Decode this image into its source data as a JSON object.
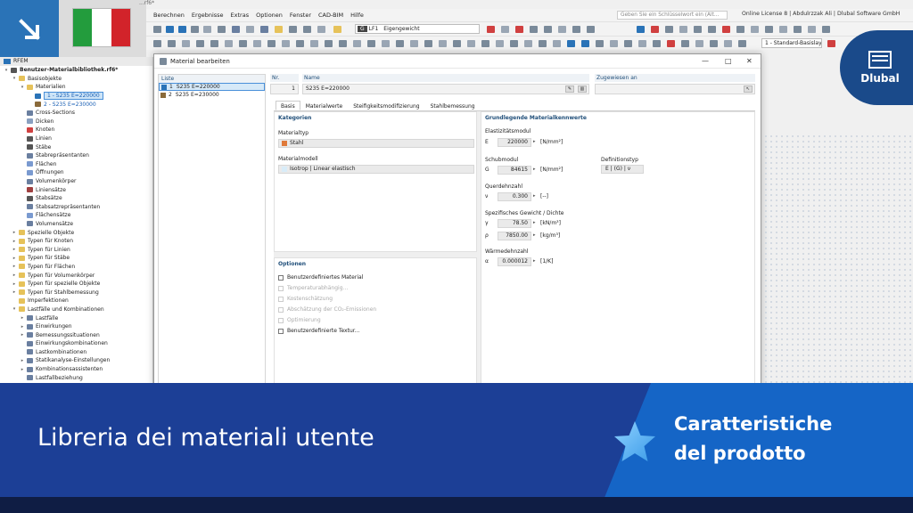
{
  "app": {
    "file_title": "...rf6*",
    "menu": [
      "Berechnen",
      "Ergebnisse",
      "Extras",
      "Optionen",
      "Fenster",
      "CAD-BIM",
      "Hilfe"
    ],
    "search_placeholder": "Geben Sie ein Schlüsselwort ein (Alt...",
    "license": "Online License 8 | Abdulrzzak Ali | Dlubal Software GmbH",
    "loadcase_tag": "G",
    "loadcase_id": "LF1",
    "loadcase_name": "Eigengewicht",
    "layer": "1 - Standard-Basislayer"
  },
  "navigator": {
    "title": "RFEM",
    "rows": [
      {
        "label": "Benutzer-Materialbibliothek.rf6*",
        "indent": 0,
        "tw": "▾",
        "color": "#555555",
        "bold": true
      },
      {
        "label": "Basisobjekte",
        "indent": 1,
        "tw": "▾",
        "color": "#e6c25a"
      },
      {
        "label": "Materialien",
        "indent": 2,
        "tw": "▾",
        "color": "#e6c25a"
      },
      {
        "label": "1 - S235 E=220000",
        "indent": 3,
        "tw": "",
        "color": "#2a73b7",
        "sel": true
      },
      {
        "label": "2 - S235 E=230000",
        "indent": 3,
        "tw": "",
        "color": "#8a6a3a",
        "blue": true
      },
      {
        "label": "Cross-Sections",
        "indent": 2,
        "tw": "",
        "color": "#6a7fa0"
      },
      {
        "label": "Dicken",
        "indent": 2,
        "tw": "",
        "color": "#8aa0c0"
      },
      {
        "label": "Knoten",
        "indent": 2,
        "tw": "",
        "color": "#d04040"
      },
      {
        "label": "Linien",
        "indent": 2,
        "tw": "",
        "color": "#555555"
      },
      {
        "label": "Stäbe",
        "indent": 2,
        "tw": "",
        "color": "#555555"
      },
      {
        "label": "Stabrepräsentanten",
        "indent": 2,
        "tw": "",
        "color": "#6a7fa0"
      },
      {
        "label": "Flächen",
        "indent": 2,
        "tw": "",
        "color": "#7a9ad0"
      },
      {
        "label": "Öffnungen",
        "indent": 2,
        "tw": "",
        "color": "#7a9ad0"
      },
      {
        "label": "Volumenkörper",
        "indent": 2,
        "tw": "",
        "color": "#6a7fa0"
      },
      {
        "label": "Liniensätze",
        "indent": 2,
        "tw": "",
        "color": "#a04040"
      },
      {
        "label": "Stabsätze",
        "indent": 2,
        "tw": "",
        "color": "#555555"
      },
      {
        "label": "Stabsatzrepräsentanten",
        "indent": 2,
        "tw": "",
        "color": "#6a7fa0"
      },
      {
        "label": "Flächensätze",
        "indent": 2,
        "tw": "",
        "color": "#7a9ad0"
      },
      {
        "label": "Volumensätze",
        "indent": 2,
        "tw": "",
        "color": "#6a7fa0"
      },
      {
        "label": "Spezielle Objekte",
        "indent": 1,
        "tw": "▸",
        "color": "#e6c25a"
      },
      {
        "label": "Typen für Knoten",
        "indent": 1,
        "tw": "▸",
        "color": "#e6c25a"
      },
      {
        "label": "Typen für Linien",
        "indent": 1,
        "tw": "▸",
        "color": "#e6c25a"
      },
      {
        "label": "Typen für Stäbe",
        "indent": 1,
        "tw": "▸",
        "color": "#e6c25a"
      },
      {
        "label": "Typen für Flächen",
        "indent": 1,
        "tw": "▸",
        "color": "#e6c25a"
      },
      {
        "label": "Typen für Volumenkörper",
        "indent": 1,
        "tw": "▸",
        "color": "#e6c25a"
      },
      {
        "label": "Typen für spezielle Objekte",
        "indent": 1,
        "tw": "▸",
        "color": "#e6c25a"
      },
      {
        "label": "Typen für Stahlbemessung",
        "indent": 1,
        "tw": "▸",
        "color": "#e6c25a"
      },
      {
        "label": "Imperfektionen",
        "indent": 1,
        "tw": "",
        "color": "#e6c25a"
      },
      {
        "label": "Lastfälle und Kombinationen",
        "indent": 1,
        "tw": "▾",
        "color": "#e6c25a"
      },
      {
        "label": "Lastfälle",
        "indent": 2,
        "tw": "▸",
        "color": "#6a7fa0"
      },
      {
        "label": "Einwirkungen",
        "indent": 2,
        "tw": "▸",
        "color": "#6a7fa0"
      },
      {
        "label": "Bemessungssituationen",
        "indent": 2,
        "tw": "▸",
        "color": "#6a7fa0"
      },
      {
        "label": "Einwirkungskombinationen",
        "indent": 2,
        "tw": "",
        "color": "#6a7fa0"
      },
      {
        "label": "Lastkombinationen",
        "indent": 2,
        "tw": "",
        "color": "#6a7fa0"
      },
      {
        "label": "Statikanalyse-Einstellungen",
        "indent": 2,
        "tw": "▸",
        "color": "#6a7fa0"
      },
      {
        "label": "Kombinationsassistenten",
        "indent": 2,
        "tw": "▸",
        "color": "#6a7fa0"
      },
      {
        "label": "Lastfallbeziehung",
        "indent": 2,
        "tw": "",
        "color": "#6a7fa0"
      }
    ]
  },
  "dialog": {
    "title": "Material bearbeiten",
    "list_header": "Liste",
    "list": [
      {
        "no": "1",
        "name": "S235 E=220000",
        "color": "#2a73b7"
      },
      {
        "no": "2",
        "name": "S235 E=230000",
        "color": "#8a6a3a"
      }
    ],
    "nr_header": "Nr.",
    "nr_value": "1",
    "name_header": "Name",
    "name_value": "S235 E=220000",
    "assigned_header": "Zugewiesen an",
    "tabs": [
      "Basis",
      "Materialwerte",
      "Steifigkeitsmodifizierung",
      "Stahlbemessung"
    ],
    "categories": {
      "header": "Kategorien",
      "material_type_label": "Materialtyp",
      "material_type_value": "Stahl",
      "material_model_label": "Materialmodell",
      "material_model_value": "Isotrop | Linear elastisch"
    },
    "options": {
      "header": "Optionen",
      "items": [
        {
          "label": "Benutzerdefiniertes Material",
          "disabled": false
        },
        {
          "label": "Temperaturabhängig...",
          "disabled": true
        },
        {
          "label": "Kostenschätzung",
          "disabled": true
        },
        {
          "label": "Abschätzung der CO₂-Emissionen",
          "disabled": true
        },
        {
          "label": "Optimierung",
          "disabled": true
        },
        {
          "label": "Benutzerdefinierte Textur...",
          "disabled": false
        }
      ]
    },
    "properties": {
      "header": "Grundlegende Materialkennwerte",
      "elastic_header": "Elastizitätsmodul",
      "E_sym": "E",
      "E_val": "220000",
      "E_unit": "[N/mm²]",
      "shear_header": "Schubmodul",
      "G_sym": "G",
      "G_val": "84615",
      "G_unit": "[N/mm²]",
      "deftype_header": "Definitionstyp",
      "deftype_val": "E | (G) | ν",
      "poisson_header": "Querdehnzahl",
      "nu_sym": "ν",
      "nu_val": "0.300",
      "nu_unit": "[--]",
      "weight_header": "Spezifisches Gewicht / Dichte",
      "gamma_sym": "γ",
      "gamma_val": "78.50",
      "gamma_unit": "[kN/m³]",
      "rho_sym": "ρ",
      "rho_val": "7850.00",
      "rho_unit": "[kg/m³]",
      "thermal_header": "Wärmedehnzahl",
      "alpha_sym": "α",
      "alpha_val": "0.000012",
      "alpha_unit": "[1/K]"
    }
  },
  "brand": {
    "name": "Dlubal"
  },
  "banner": {
    "title": "Libreria dei materiali utente",
    "subtitle_line1": "Caratteristiche",
    "subtitle_line2": "del prodotto"
  }
}
